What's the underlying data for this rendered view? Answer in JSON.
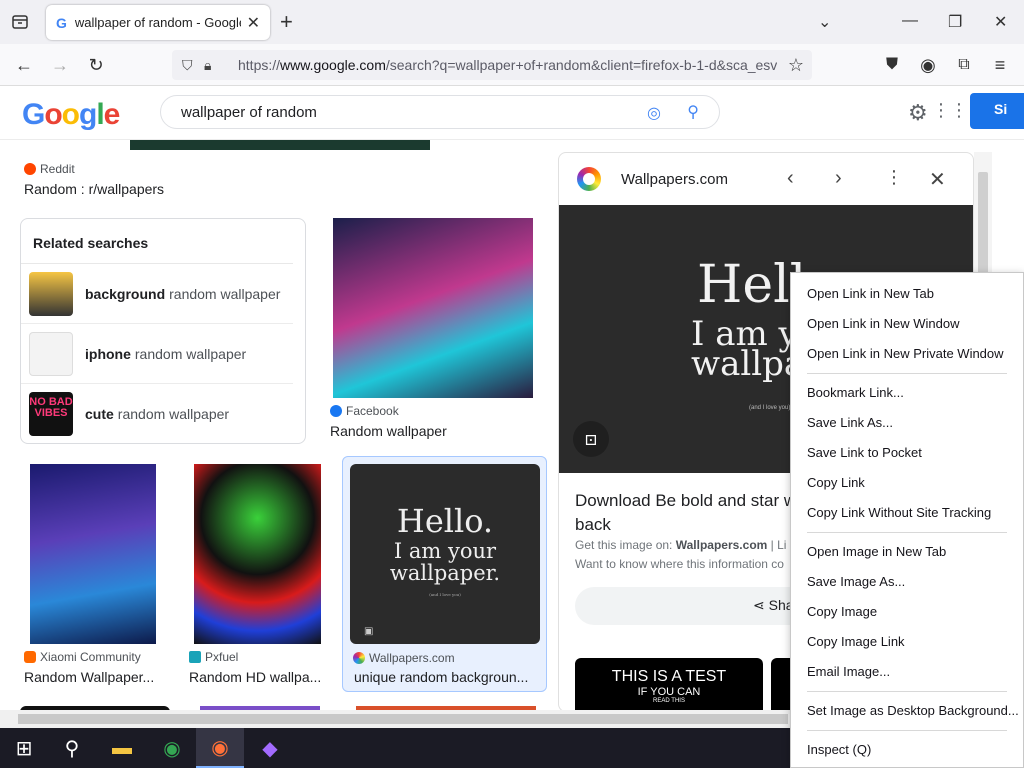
{
  "browser": {
    "tab_title": "wallpaper of random - Google Search",
    "tab_icon": "G",
    "url_host": "www.google.com",
    "url_prefix": "https://",
    "url_rest": "/search?q=wallpaper+of+random&client=firefox-b-1-d&sca_esv"
  },
  "google": {
    "logo": "Google",
    "query": "wallpaper of random",
    "signin": "Si"
  },
  "results": {
    "reddit_source": "Reddit",
    "reddit_title": "Random : r/wallpapers",
    "related_heading": "Related searches",
    "related": [
      {
        "bold": "background",
        "rest": "random wallpaper"
      },
      {
        "bold": "iphone",
        "rest": "random wallpaper"
      },
      {
        "bold": "cute",
        "rest": "random wallpaper"
      }
    ],
    "related_thumb_text": "NO BAD VIBES",
    "facebook_source": "Facebook",
    "facebook_title": "Random wallpaper",
    "xiaomi_source": "Xiaomi Community",
    "xiaomi_title": "Random Wallpaper...",
    "pxfuel_source": "Pxfuel",
    "pxfuel_title": "Random HD wallpa...",
    "wallpapers_source": "Wallpapers.com",
    "wallpapers_title": "unique random backgroun...",
    "hello_card": {
      "l1": "Hello.",
      "l2": "I am your",
      "l3": "wallpaper.",
      "l4": "(and I love you)"
    }
  },
  "panel": {
    "site": "Wallpapers.com",
    "img_l1": "Hell",
    "img_l2": "I am y",
    "img_l3": "wallpa",
    "img_small": "(and I love you)",
    "title": "Download Be bold and star with a unique random back",
    "get_image": "Get this image on:",
    "get_image_site": "Wallpapers.com",
    "get_image_sep": "| Li",
    "know_where": "Want to know where this information co",
    "share": "Shar",
    "test_a": "THIS IS A TEST",
    "test_b": "IF YOU CAN",
    "test_c": "READ THIS"
  },
  "context_menu": {
    "group1": [
      "Open Link in New Tab",
      "Open Link in New Window",
      "Open Link in New Private Window"
    ],
    "group2": [
      "Bookmark Link...",
      "Save Link As...",
      "Save Link to Pocket",
      "Copy Link",
      "Copy Link Without Site Tracking"
    ],
    "group3": [
      "Open Image in New Tab",
      "Save Image As...",
      "Copy Image",
      "Copy Image Link",
      "Email Image..."
    ],
    "group4": [
      "Set Image as Desktop Background..."
    ],
    "group5": [
      "Inspect (Q)"
    ]
  },
  "colors": {
    "accent": "#1a73e8",
    "selected_card": "#e8f0fe"
  }
}
